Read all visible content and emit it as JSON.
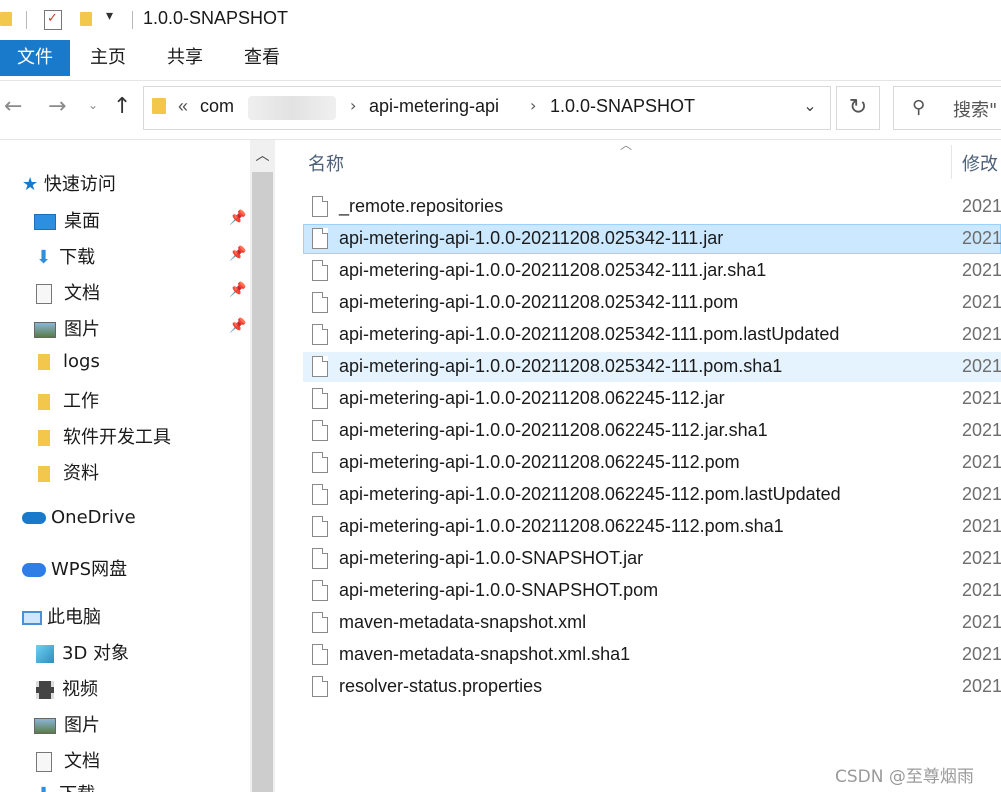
{
  "window": {
    "title": "1.0.0-SNAPSHOT"
  },
  "ribbon": {
    "tabs": [
      "文件",
      "主页",
      "共享",
      "查看"
    ]
  },
  "address": {
    "root_chevron": "«",
    "crumbs": [
      "com",
      "api-metering-api",
      "1.0.0-SNAPSHOT"
    ],
    "separator": "›",
    "dropdown": "⌄",
    "refresh": "↻"
  },
  "search": {
    "placeholder": "搜索\""
  },
  "nav": {
    "quick_access": "快速访问",
    "items": [
      {
        "label": "桌面",
        "icon": "desktop-icon",
        "pinned": true
      },
      {
        "label": "下载",
        "icon": "download-icon",
        "pinned": true
      },
      {
        "label": "文档",
        "icon": "document-icon",
        "pinned": true
      },
      {
        "label": "图片",
        "icon": "picture-icon",
        "pinned": true
      },
      {
        "label": "logs",
        "icon": "folder-icon",
        "pinned": false
      },
      {
        "label": "工作",
        "icon": "folder-icon",
        "pinned": false
      },
      {
        "label": "软件开发工具",
        "icon": "folder-icon",
        "pinned": false
      },
      {
        "label": "资料",
        "icon": "folder-icon",
        "pinned": false
      }
    ],
    "onedrive": "OneDrive",
    "wps": "WPS网盘",
    "this_pc": "此电脑",
    "pc_items": [
      {
        "label": "3D 对象",
        "icon": "3d-objects-icon"
      },
      {
        "label": "视频",
        "icon": "video-icon"
      },
      {
        "label": "图片",
        "icon": "picture-icon"
      },
      {
        "label": "文档",
        "icon": "document-icon"
      },
      {
        "label": "下载",
        "icon": "download-icon"
      }
    ]
  },
  "list": {
    "columns": {
      "name": "名称",
      "modified": "修改"
    },
    "rows": [
      {
        "name": "_remote.repositories",
        "date": "2021"
      },
      {
        "name": "api-metering-api-1.0.0-20211208.025342-111.jar",
        "date": "2021",
        "state": "selected"
      },
      {
        "name": "api-metering-api-1.0.0-20211208.025342-111.jar.sha1",
        "date": "2021"
      },
      {
        "name": "api-metering-api-1.0.0-20211208.025342-111.pom",
        "date": "2021"
      },
      {
        "name": "api-metering-api-1.0.0-20211208.025342-111.pom.lastUpdated",
        "date": "2021"
      },
      {
        "name": "api-metering-api-1.0.0-20211208.025342-111.pom.sha1",
        "date": "2021",
        "state": "hover"
      },
      {
        "name": "api-metering-api-1.0.0-20211208.062245-112.jar",
        "date": "2021"
      },
      {
        "name": "api-metering-api-1.0.0-20211208.062245-112.jar.sha1",
        "date": "2021"
      },
      {
        "name": "api-metering-api-1.0.0-20211208.062245-112.pom",
        "date": "2021"
      },
      {
        "name": "api-metering-api-1.0.0-20211208.062245-112.pom.lastUpdated",
        "date": "2021"
      },
      {
        "name": "api-metering-api-1.0.0-20211208.062245-112.pom.sha1",
        "date": "2021"
      },
      {
        "name": "api-metering-api-1.0.0-SNAPSHOT.jar",
        "date": "2021"
      },
      {
        "name": "api-metering-api-1.0.0-SNAPSHOT.pom",
        "date": "2021"
      },
      {
        "name": "maven-metadata-snapshot.xml",
        "date": "2021"
      },
      {
        "name": "maven-metadata-snapshot.xml.sha1",
        "date": "2021"
      },
      {
        "name": "resolver-status.properties",
        "date": "2021"
      }
    ]
  },
  "watermark": "CSDN @至尊烟雨",
  "colors": {
    "accent": "#1979ca",
    "selection": "#cce8ff",
    "hover": "#e5f3ff",
    "folder": "#f3c74b"
  }
}
